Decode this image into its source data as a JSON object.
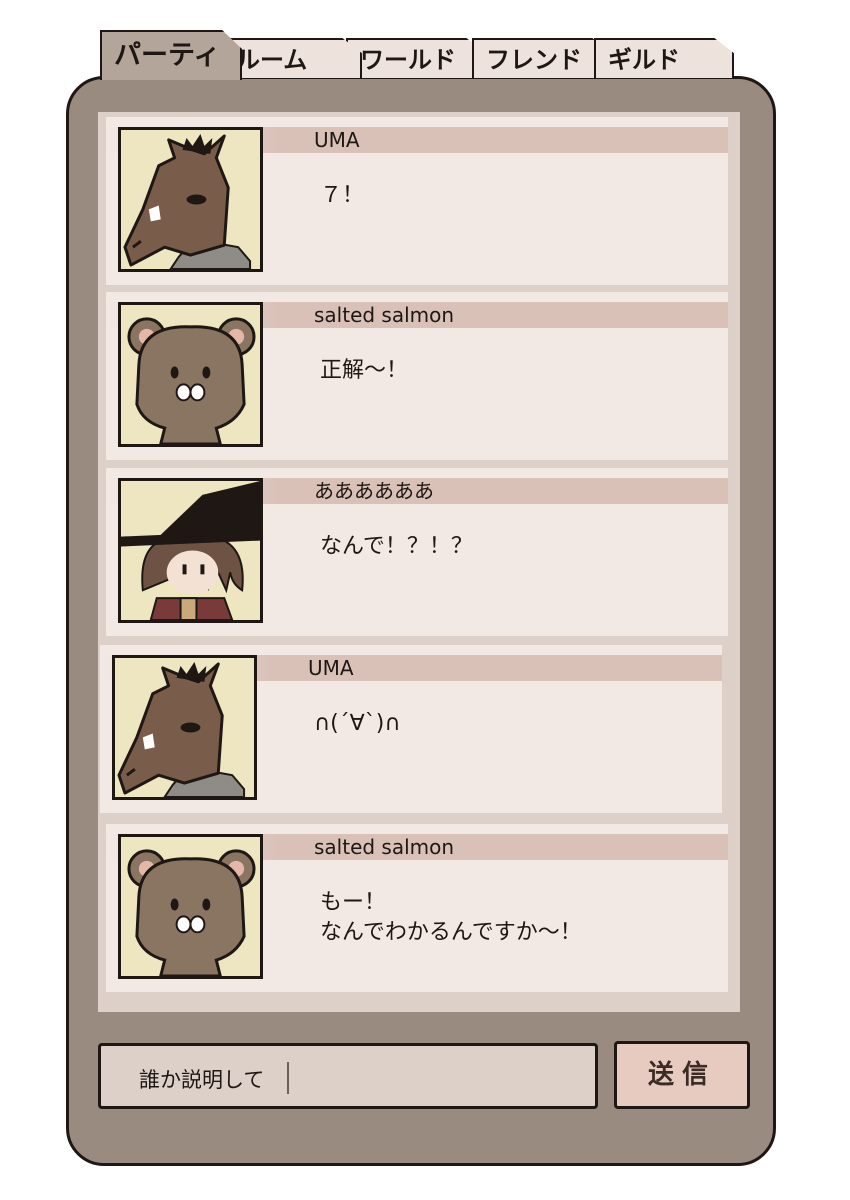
{
  "tabs": [
    {
      "label": "パーティ",
      "active": true
    },
    {
      "label": "ルーム",
      "active": false
    },
    {
      "label": "ワールド",
      "active": false
    },
    {
      "label": "フレンド",
      "active": false
    },
    {
      "label": "ギルド",
      "active": false
    }
  ],
  "messages": [
    {
      "name": "UMA",
      "text": "７！",
      "avatar": "horse-mask-avatar"
    },
    {
      "name": "salted salmon",
      "text": "正解〜！",
      "avatar": "bear-avatar"
    },
    {
      "name": "ああああああ",
      "text": "なんで！？！？",
      "avatar": "witch-hat-avatar"
    },
    {
      "name": "UMA",
      "text": "∩(´∀`)∩",
      "avatar": "horse-mask-avatar"
    },
    {
      "name": "salted salmon",
      "text": "もー！\nなんでわかるんですか〜！",
      "avatar": "bear-avatar"
    }
  ],
  "input": {
    "value": "誰か説明して"
  },
  "send_label": "送信",
  "colors": {
    "panel": "#9a8b81",
    "message_bg": "#f2e9e5",
    "name_bar": "#d9c1b8",
    "active_tab": "#b4a59b",
    "avatar_bg": "#ede6c1",
    "send_button": "#e8cbc0"
  }
}
